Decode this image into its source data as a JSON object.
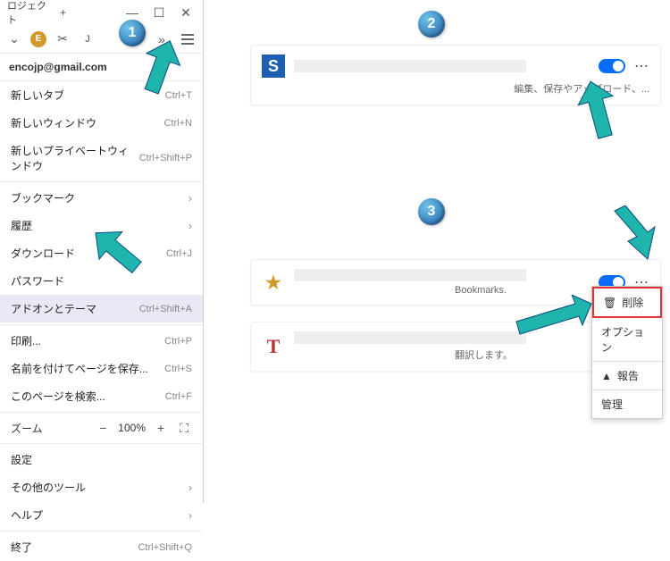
{
  "window": {
    "title": "ロジェクト",
    "plus": "+"
  },
  "account": "encojp@gmail.com",
  "menu": {
    "new_tab": {
      "label": "新しいタブ",
      "shortcut": "Ctrl+T"
    },
    "new_window": {
      "label": "新しいウィンドウ",
      "shortcut": "Ctrl+N"
    },
    "new_private": {
      "label": "新しいプライベートウィンドウ",
      "shortcut": "Ctrl+Shift+P"
    },
    "bookmarks": {
      "label": "ブックマーク"
    },
    "history": {
      "label": "履歴"
    },
    "downloads": {
      "label": "ダウンロード",
      "shortcut": "Ctrl+J"
    },
    "passwords": {
      "label": "パスワード"
    },
    "addons": {
      "label": "アドオンとテーマ",
      "shortcut": "Ctrl+Shift+A"
    },
    "print": {
      "label": "印刷...",
      "shortcut": "Ctrl+P"
    },
    "save_as": {
      "label": "名前を付けてページを保存...",
      "shortcut": "Ctrl+S"
    },
    "find": {
      "label": "このページを検索...",
      "shortcut": "Ctrl+F"
    },
    "zoom": {
      "label": "ズーム",
      "value": "100%"
    },
    "settings": {
      "label": "設定"
    },
    "more_tools": {
      "label": "その他のツール"
    },
    "help": {
      "label": "ヘルプ"
    },
    "quit": {
      "label": "終了",
      "shortcut": "Ctrl+Shift+Q"
    }
  },
  "addons": {
    "a1": {
      "subtitle": "編集、保存やアップロード、..."
    },
    "a2": {
      "subtitle": "Bookmarks."
    },
    "a3": {
      "subtitle": "翻訳します。"
    }
  },
  "context": {
    "remove": "削除",
    "options": "オプション",
    "report": "報告",
    "manage": "管理"
  },
  "dots": "⋯",
  "chev": "›",
  "badges": {
    "b1": "1",
    "b2": "2",
    "b3": "3"
  }
}
